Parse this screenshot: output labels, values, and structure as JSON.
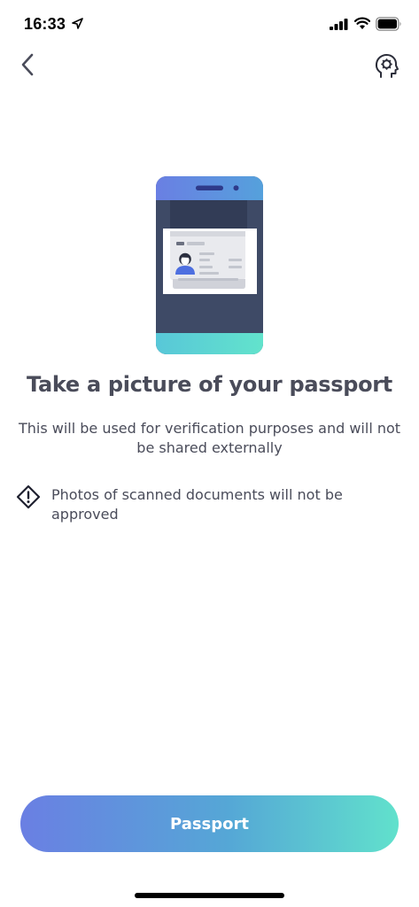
{
  "status_bar": {
    "time": "16:33",
    "icons": [
      "location-arrow-icon",
      "cellular-signal-icon",
      "wifi-icon",
      "battery-icon"
    ]
  },
  "nav": {
    "back_icon": "chevron-left-icon",
    "support_icon": "support-head-icon"
  },
  "content": {
    "illustration": "phone-with-passport-illustration",
    "title": "Take a picture of your passport",
    "subtitle": "This will be used for verification purposes and will not be shared externally",
    "warning_icon": "warning-diamond-icon",
    "warning_text": "Photos of scanned documents will not be approved"
  },
  "actions": {
    "primary_label": "Passport"
  },
  "colors": {
    "gradient_start": "#6a7fe3",
    "gradient_mid": "#55a7d6",
    "gradient_end": "#61e1cc",
    "phone_body": "#3e4a66",
    "text": "#4a4c5a"
  }
}
